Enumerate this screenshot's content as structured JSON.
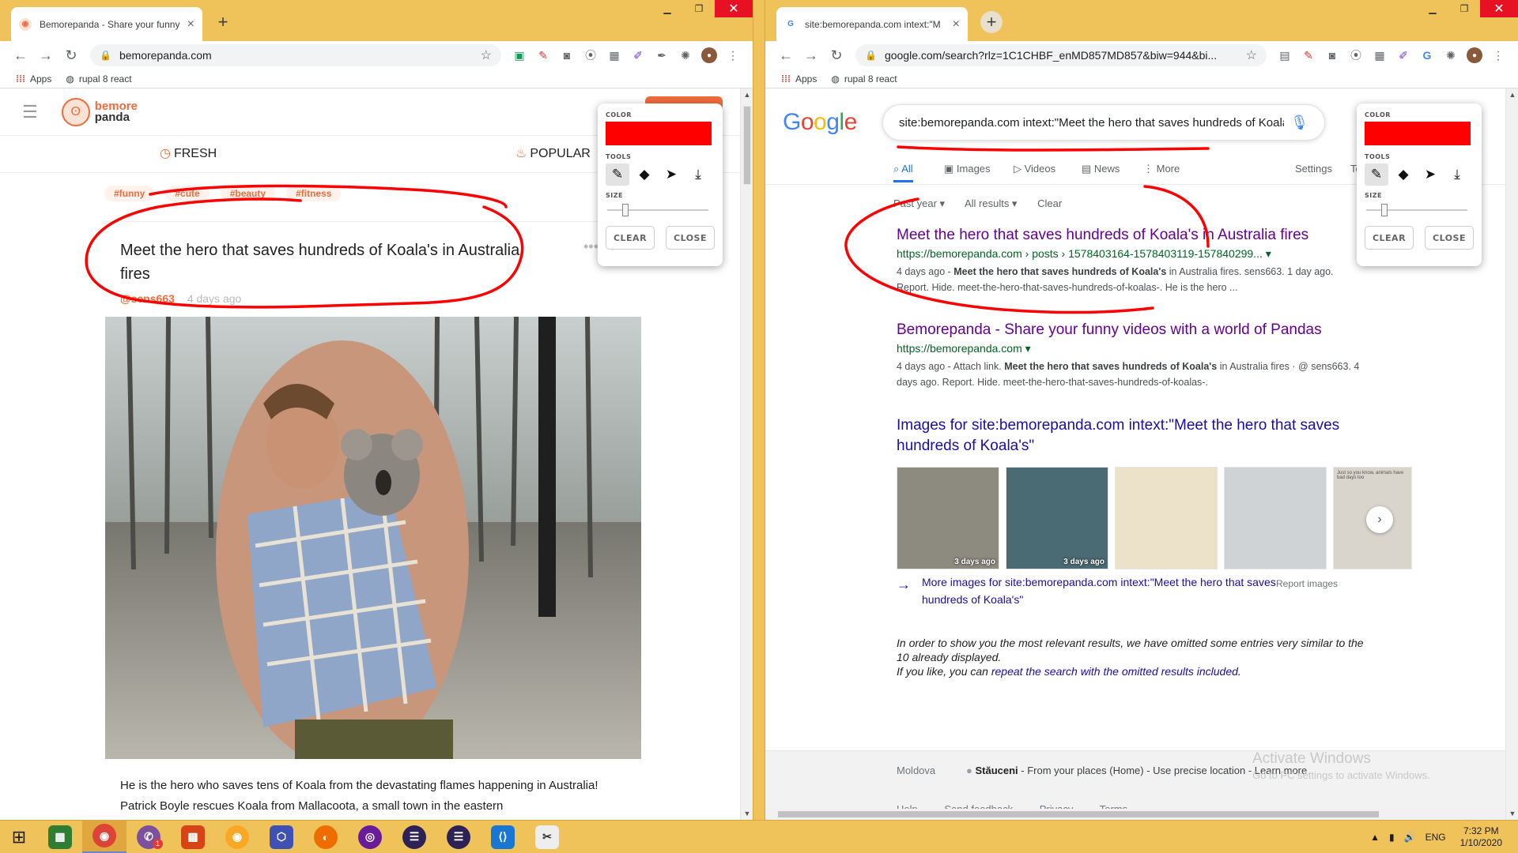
{
  "left": {
    "tab_title": "Bemorepanda - Share your funny",
    "url": "bemorepanda.com",
    "bookmarks": [
      "Apps",
      "rupal 8 react"
    ],
    "logo": {
      "line1": "bemore",
      "line2": "panda"
    },
    "tabs": {
      "fresh": "FRESH",
      "popular": "POPULAR"
    },
    "tags": [
      "#funny",
      "#cute",
      "#beauty",
      "#fitness"
    ],
    "post": {
      "title": "Meet the hero that saves hundreds of Koala's in Australia fires",
      "author": "@sens663",
      "date": "4 days ago",
      "body": "He is the hero who saves tens of Koala from the devastating flames happening in Australia! Patrick Boyle rescues Koala from Mallacoota, a small town in the eastern"
    }
  },
  "right": {
    "tab_title": "site:bemorepanda.com intext:\"M",
    "url": "google.com/search?rlz=1C1CHBF_enMD857MD857&biw=944&bi...",
    "bookmarks": [
      "Apps",
      "rupal 8 react"
    ],
    "query": "site:bemorepanda.com intext:\"Meet the hero that saves hundreds of Koala'",
    "tabs": {
      "all": "All",
      "images": "Images",
      "videos": "Videos",
      "news": "News",
      "more": "More",
      "settings": "Settings",
      "tools": "To"
    },
    "filters": [
      "Past year ▾",
      "All results ▾",
      "Clear"
    ],
    "results": [
      {
        "title": "Meet the hero that saves hundreds of Koala's in Australia fires",
        "url": "https://bemorepanda.com › posts › 1578403164-1578403119-157840299... ▾",
        "snippet_date": "4 days ago - ",
        "snippet_bold": "Meet the hero that saves hundreds of Koala's",
        "snippet_rest": " in Australia fires. sens663. 1 day ago. Report. Hide. meet-the-hero-that-saves-hundreds-of-koalas-. He is the hero ..."
      },
      {
        "title": "Bemorepanda - Share your funny videos with a world of Pandas",
        "url": "https://bemorepanda.com ▾",
        "snippet_date": "4 days ago - Attach link. ",
        "snippet_bold": "Meet the hero that saves hundreds of Koala's",
        "snippet_rest": " in Australia fires · @ sens663. 4 days ago. Report. Hide. meet-the-hero-that-saves-hundreds-of-koalas-."
      }
    ],
    "images_heading": "Images for site:bemorepanda.com intext:\"Meet the hero that saves hundreds of Koala's\"",
    "thumbs": [
      {
        "ago": "3 days ago",
        "color": "#8d8a80"
      },
      {
        "ago": "3 days ago",
        "color": "#4a6b74"
      },
      {
        "ago": "",
        "color": "#ece2c9"
      },
      {
        "ago": "",
        "color": "#cfd3d6"
      },
      {
        "ago": "",
        "color": "#d9d4cc"
      }
    ],
    "thumb5_text": "Just so you know, animals have bad days too",
    "more_images": "More images for site:bemorepanda.com intext:\"Meet the hero that saves hundreds of Koala's\"",
    "report_images": "Report images",
    "omitted_1": "In order to show you the most relevant results, we have omitted some entries very similar to the 10 already displayed.",
    "omitted_2": "If you like, you can ",
    "omitted_link": "repeat the search with the omitted results included.",
    "footer": {
      "country": "Moldova",
      "place_bold": "Stăuceni",
      "place_rest": " - From your places (Home) - Use precise location - Learn more",
      "links": [
        "Help",
        "Send feedback",
        "Privacy",
        "Terms"
      ]
    },
    "activate_line1": "Activate Windows",
    "activate_line2": "Go to PC settings to activate Windows."
  },
  "draw_panel": {
    "color_label": "COLOR",
    "tools_label": "TOOLS",
    "size_label": "SIZE",
    "clear": "CLEAR",
    "close": "CLOSE",
    "color": "#ff0000",
    "size_level": 0.15
  },
  "taskbar": {
    "viber_badge": "1",
    "lang": "ENG",
    "time": "7:32 PM",
    "date": "1/10/2020"
  },
  "colors": {
    "annotation": "#ff0000",
    "brand": "#f26b3a",
    "google_link": "#1a0dab"
  }
}
